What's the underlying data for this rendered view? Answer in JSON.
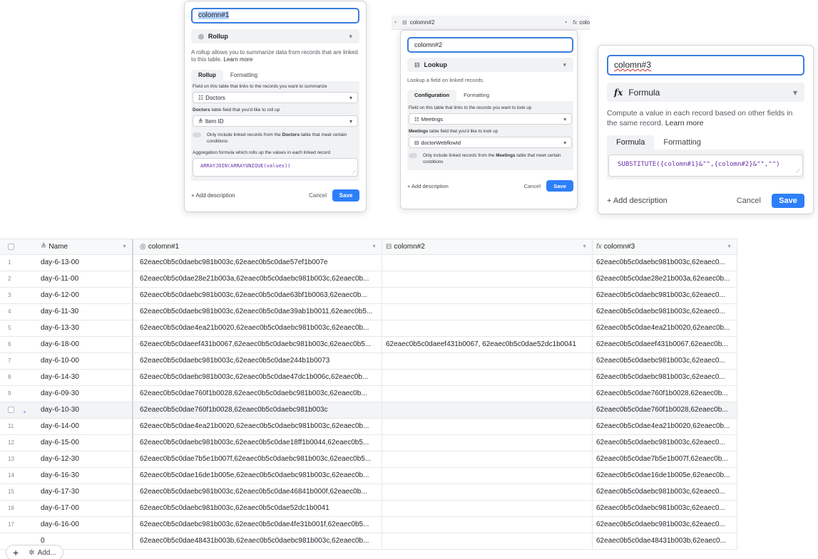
{
  "panel1": {
    "name_value": "colomn#1",
    "type_label": "Rollup",
    "type_icon": "rollup-icon",
    "description": "A rollup allows you to summarize data from records that are linked to this table.",
    "learn_more": "Learn more",
    "tabs": [
      "Rollup",
      "Formatting"
    ],
    "link_field_label": "Field on this table that links to the records you want to summarize",
    "link_field_value": "Doctors",
    "rollup_field_label_prefix": "Doctors",
    "rollup_field_label_rest": " table field that you'd like to roll up",
    "rollup_field_value": "Item ID",
    "condition_prefix": "Only include linked records from the ",
    "condition_table": "Doctors",
    "condition_suffix": " table that meet certain conditions",
    "aggregation_label": "Aggregation formula which rolls up the values in each linked record",
    "formula": "ARRAYJOIN(ARRAYUNIQUE(values))",
    "add_description": "+ Add description",
    "cancel": "Cancel",
    "save": "Save"
  },
  "panel2": {
    "name_value": "colomn#2",
    "type_label": "Lookup",
    "type_icon": "lookup-icon",
    "description": "Lookup a field on linked records.",
    "tabs": [
      "Configuration",
      "Formatting"
    ],
    "link_field_label": "Field on this table that links to the records you want to look up",
    "link_field_value": "Meetings",
    "lookup_field_label_prefix": "Meetings",
    "lookup_field_label_rest": " table field that you'd like to look up",
    "lookup_field_value": "doctorWebflowId",
    "condition_prefix": "Only include linked records from the ",
    "condition_table": "Meetings",
    "condition_suffix": " table that meet certain conditions",
    "add_description": "+ Add description",
    "cancel": "Cancel",
    "save": "Save"
  },
  "panel3": {
    "name_value": "colomn#3",
    "type_label": "Formula",
    "type_icon": "formula-icon",
    "description": "Compute a value in each record based on other fields in the same record.",
    "learn_more": "Learn more",
    "tabs": [
      "Formula",
      "Formatting"
    ],
    "formula": "SUBSTITUTE({colomn#1}&\"\",{colomn#2}&\"\",\"\")",
    "add_description": "+ Add description",
    "cancel": "Cancel",
    "save": "Save"
  },
  "bg_header": {
    "col2": "colomn#2",
    "col3": "colo"
  },
  "table": {
    "columns": [
      {
        "label": "Name",
        "icon": "text-field-icon"
      },
      {
        "label": "colomn#1",
        "icon": "rollup-icon"
      },
      {
        "label": "colomn#2",
        "icon": "lookup-icon"
      },
      {
        "label": "colomn#3",
        "icon": "formula-icon"
      }
    ],
    "rows": [
      {
        "n": "1",
        "name": "day-6-13-00",
        "a": "62eaec0b5c0daebc981b003c,62eaec0b5c0dae57ef1b007e",
        "b": "",
        "c": "62eaec0b5c0daebc981b003c,62eaec0..."
      },
      {
        "n": "2",
        "name": "day-6-11-00",
        "a": "62eaec0b5c0dae28e21b003a,62eaec0b5c0daebc981b003c,62eaec0b...",
        "b": "",
        "c": "62eaec0b5c0dae28e21b003a,62eaec0b..."
      },
      {
        "n": "3",
        "name": "day-6-12-00",
        "a": "62eaec0b5c0daebc981b003c,62eaec0b5c0dae63bf1b0063,62eaec0b...",
        "b": "",
        "c": "62eaec0b5c0daebc981b003c,62eaec0..."
      },
      {
        "n": "4",
        "name": "day-6-11-30",
        "a": "62eaec0b5c0daebc981b003c,62eaec0b5c0dae39ab1b0011,62eaec0b5...",
        "b": "",
        "c": "62eaec0b5c0daebc981b003c,62eaec0..."
      },
      {
        "n": "5",
        "name": "day-6-13-30",
        "a": "62eaec0b5c0dae4ea21b0020,62eaec0b5c0daebc981b003c,62eaec0b...",
        "b": "",
        "c": "62eaec0b5c0dae4ea21b0020,62eaec0b..."
      },
      {
        "n": "6",
        "name": "day-6-18-00",
        "a": "62eaec0b5c0daeef431b0067,62eaec0b5c0daebc981b003c,62eaec0b5...",
        "b": "62eaec0b5c0daeef431b0067, 62eaec0b5c0dae52dc1b0041",
        "c": "62eaec0b5c0daeef431b0067,62eaec0b..."
      },
      {
        "n": "7",
        "name": "day-6-10-00",
        "a": "62eaec0b5c0daebc981b003c,62eaec0b5c0dae244b1b0073",
        "b": "",
        "c": "62eaec0b5c0daebc981b003c,62eaec0..."
      },
      {
        "n": "8",
        "name": "day-6-14-30",
        "a": "62eaec0b5c0daebc981b003c,62eaec0b5c0dae47dc1b006c,62eaec0b...",
        "b": "",
        "c": "62eaec0b5c0daebc981b003c,62eaec0..."
      },
      {
        "n": "9",
        "name": "day-6-09-30",
        "a": "62eaec0b5c0dae760f1b0028,62eaec0b5c0daebc981b003c,62eaec0b...",
        "b": "",
        "c": "62eaec0b5c0dae760f1b0028,62eaec0b..."
      },
      {
        "n": "",
        "name": "day-6-10-30",
        "a": "62eaec0b5c0dae760f1b0028,62eaec0b5c0daebc981b003c",
        "b": "",
        "c": "62eaec0b5c0dae760f1b0028,62eaec0b..."
      },
      {
        "n": "11",
        "name": "day-6-14-00",
        "a": "62eaec0b5c0dae4ea21b0020,62eaec0b5c0daebc981b003c,62eaec0b...",
        "b": "",
        "c": "62eaec0b5c0dae4ea21b0020,62eaec0b..."
      },
      {
        "n": "12",
        "name": "day-6-15-00",
        "a": "62eaec0b5c0daebc981b003c,62eaec0b5c0dae18ff1b0044,62eaec0b5...",
        "b": "",
        "c": "62eaec0b5c0daebc981b003c,62eaec0..."
      },
      {
        "n": "13",
        "name": "day-6-12-30",
        "a": "62eaec0b5c0dae7b5e1b007f,62eaec0b5c0daebc981b003c,62eaec0b5...",
        "b": "",
        "c": "62eaec0b5c0dae7b5e1b007f,62eaec0b..."
      },
      {
        "n": "14",
        "name": "day-6-16-30",
        "a": "62eaec0b5c0dae16de1b005e,62eaec0b5c0daebc981b003c,62eaec0b...",
        "b": "",
        "c": "62eaec0b5c0dae16de1b005e,62eaec0b..."
      },
      {
        "n": "15",
        "name": "day-6-17-30",
        "a": "62eaec0b5c0daebc981b003c,62eaec0b5c0dae46841b000f,62eaec0b...",
        "b": "",
        "c": "62eaec0b5c0daebc981b003c,62eaec0..."
      },
      {
        "n": "16",
        "name": "day-6-17-00",
        "a": "62eaec0b5c0daebc981b003c,62eaec0b5c0dae52dc1b0041",
        "b": "",
        "c": "62eaec0b5c0daebc981b003c,62eaec0..."
      },
      {
        "n": "17",
        "name": "day-6-16-00",
        "a": "62eaec0b5c0daebc981b003c,62eaec0b5c0dae4fe31b001f,62eaec0b5...",
        "b": "",
        "c": "62eaec0b5c0daebc981b003c,62eaec0..."
      },
      {
        "n": "",
        "name": "0",
        "a": "62eaec0b5c0dae48431b003b,62eaec0b5c0daebc981b003c,62eaec0b...",
        "b": "",
        "c": "62eaec0b5c0dae48431b003b,62eaec0..."
      }
    ],
    "hovered_row_index": 9
  },
  "add_bar": {
    "plus": "+",
    "more": "Add..."
  }
}
